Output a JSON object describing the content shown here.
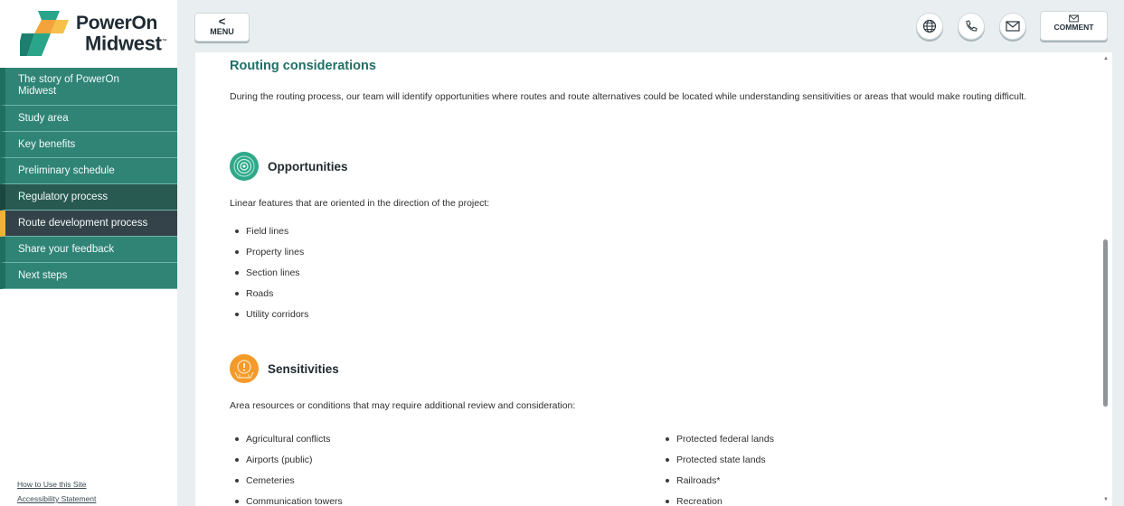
{
  "brand": {
    "name_line1": "PowerOn",
    "name_line2": "Midwest",
    "trademark": "™"
  },
  "sidebar": {
    "items": [
      {
        "label": "The story of PowerOn Midwest"
      },
      {
        "label": "Study area"
      },
      {
        "label": "Key benefits"
      },
      {
        "label": "Preliminary schedule"
      },
      {
        "label": "Regulatory process"
      },
      {
        "label": "Route development process"
      },
      {
        "label": "Share your feedback"
      },
      {
        "label": "Next steps"
      }
    ],
    "footer_links": [
      "How to Use this Site",
      "Accessibility Statement"
    ]
  },
  "topbar": {
    "menu_chevron": "<",
    "menu_label": "MENU",
    "icons": [
      "globe-icon",
      "phone-icon",
      "mail-icon"
    ],
    "comment_label": "COMMENT"
  },
  "content": {
    "title": "Routing considerations",
    "intro": "During the routing process, our team will identify opportunities where routes and route alternatives could be located while understanding sensitivities or areas that would make routing difficult.",
    "opportunities": {
      "title": "Opportunities",
      "description": "Linear features that are oriented in the direction of the project:",
      "items": [
        "Field lines",
        "Property lines",
        "Section lines",
        "Roads",
        "Utility corridors"
      ]
    },
    "sensitivities": {
      "title": "Sensitivities",
      "description": "Area resources or conditions that may require additional review and consideration:",
      "items_col1": [
        "Agricultural conflicts",
        "Airports (public)",
        "Cemeteries",
        "Communication towers"
      ],
      "items_col2": [
        "Protected federal lands",
        "Protected state lands",
        "Railroads*",
        "Recreation"
      ]
    }
  },
  "colors": {
    "teal": "#2f8476",
    "active_nav": "#344349",
    "accent_yellow": "#f2b233",
    "title_green": "#1f6f66",
    "opportunities_icon": "#2fa889",
    "sensitivities_icon": "#f39a2a"
  }
}
